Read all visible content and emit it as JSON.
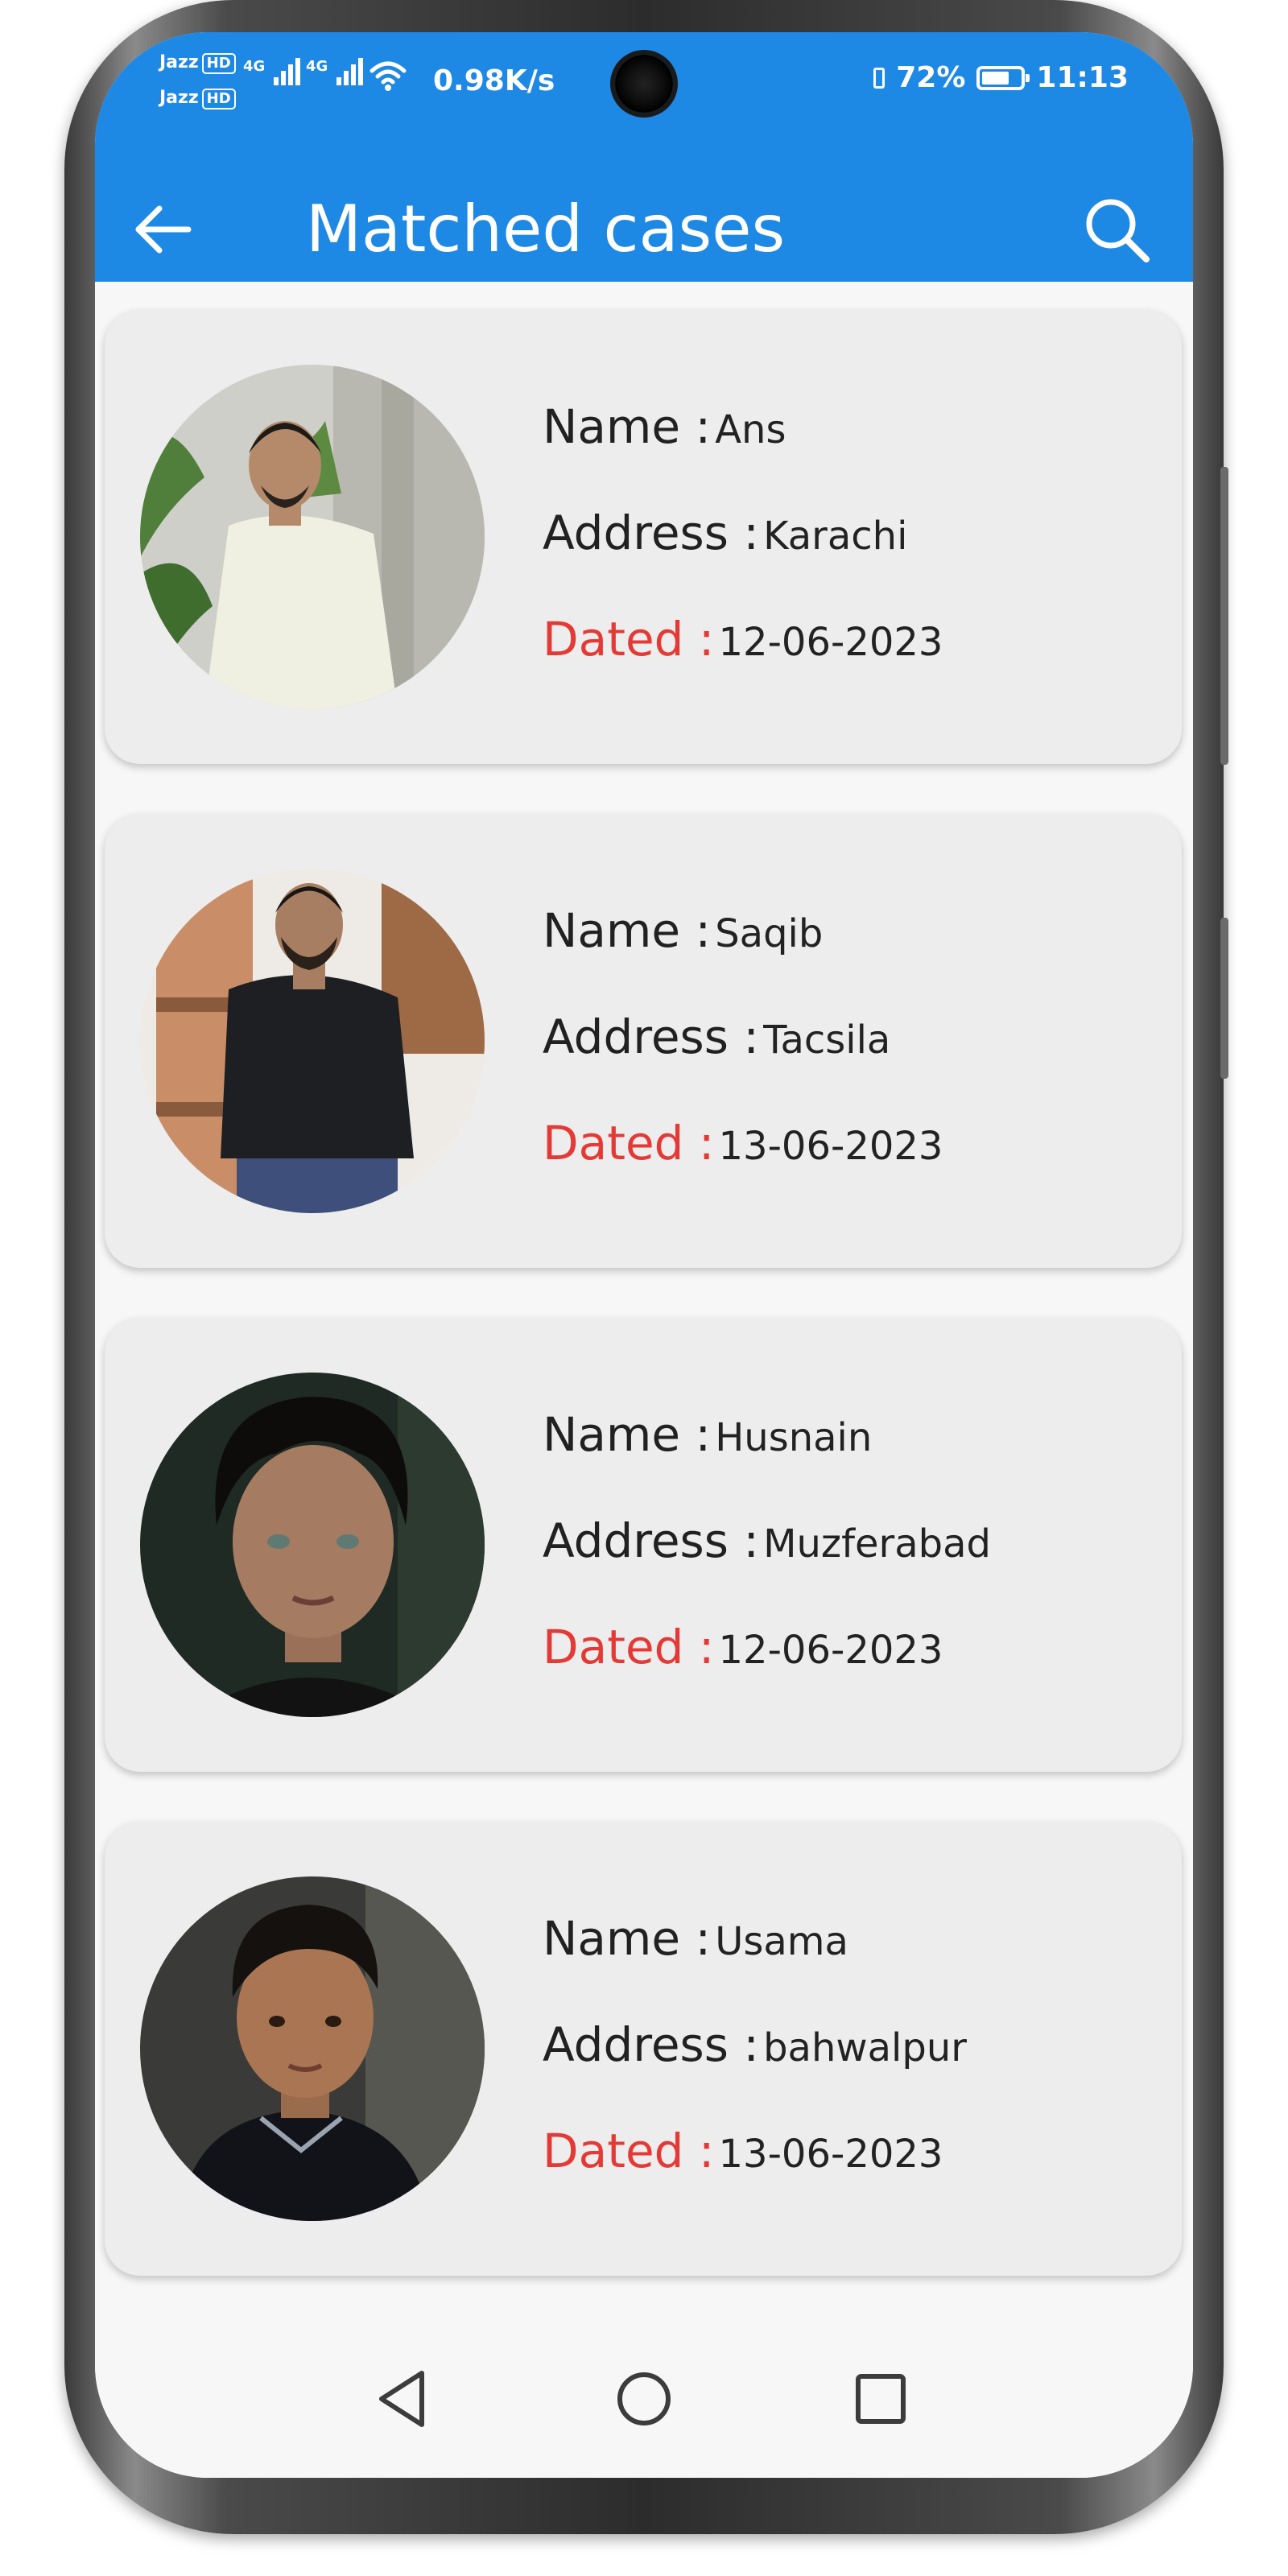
{
  "status_bar": {
    "carrier_1": "Jazz",
    "carrier_2": "Jazz",
    "hd_badge": "HD",
    "network_1": "4G",
    "network_2": "4G",
    "net_speed": "0.98K/s",
    "battery_percent": "72%",
    "battery_level": 0.72,
    "time": "11:13",
    "icons": [
      "hd-icon",
      "signal-icon",
      "wifi-icon",
      "vibrate-icon",
      "battery-icon"
    ]
  },
  "app_bar": {
    "title": "Matched cases",
    "back_icon": "arrow-left-icon",
    "search_icon": "search-icon",
    "color": "#1e88e5"
  },
  "cases": [
    {
      "name_label": "Name :",
      "name": "Ans",
      "address_label": "Address :",
      "address": "Karachi",
      "dated_label": "Dated :",
      "dated": "12-06-2023"
    },
    {
      "name_label": "Name :",
      "name": "Saqib",
      "address_label": "Address :",
      "address": "Tacsila",
      "dated_label": "Dated :",
      "dated": "13-06-2023"
    },
    {
      "name_label": "Name :",
      "name": "Husnain",
      "address_label": "Address :",
      "address": "Muzferabad",
      "dated_label": "Dated :",
      "dated": "12-06-2023"
    },
    {
      "name_label": "Name :",
      "name": "Usama",
      "address_label": "Address :",
      "address": "bahwalpur",
      "dated_label": "Dated :",
      "dated": "13-06-2023"
    }
  ],
  "colors": {
    "accent": "#1e88e5",
    "dated_label": "#e53935",
    "card_background": "#ededed"
  },
  "nav_bar": {
    "icons": [
      "back-triangle-icon",
      "home-circle-icon",
      "recents-square-icon"
    ]
  }
}
